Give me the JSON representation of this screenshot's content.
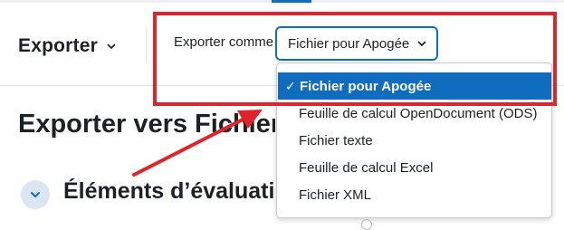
{
  "header": {
    "exporter_label": "Exporter",
    "export_as_label": "Exporter comme",
    "selected_format": "Fichier pour Apogée"
  },
  "dropdown": {
    "options": [
      {
        "label": "Fichier pour Apogée",
        "selected": true
      },
      {
        "label": "Feuille de calcul OpenDocument (ODS)",
        "selected": false
      },
      {
        "label": "Fichier texte",
        "selected": false
      },
      {
        "label": "Feuille de calcul Excel",
        "selected": false
      },
      {
        "label": "Fichier XML",
        "selected": false
      }
    ]
  },
  "main": {
    "page_title": "Exporter vers Fichier",
    "section_title": "Éléments d’évaluation"
  },
  "colors": {
    "accent": "#0f6cbf",
    "annotation_red": "#e0242b",
    "text": "#1d2125"
  },
  "icons": {
    "dropdown_chevron": "chevron-down-icon",
    "selected_check": "check-icon",
    "collapse": "chevron-down-icon"
  }
}
